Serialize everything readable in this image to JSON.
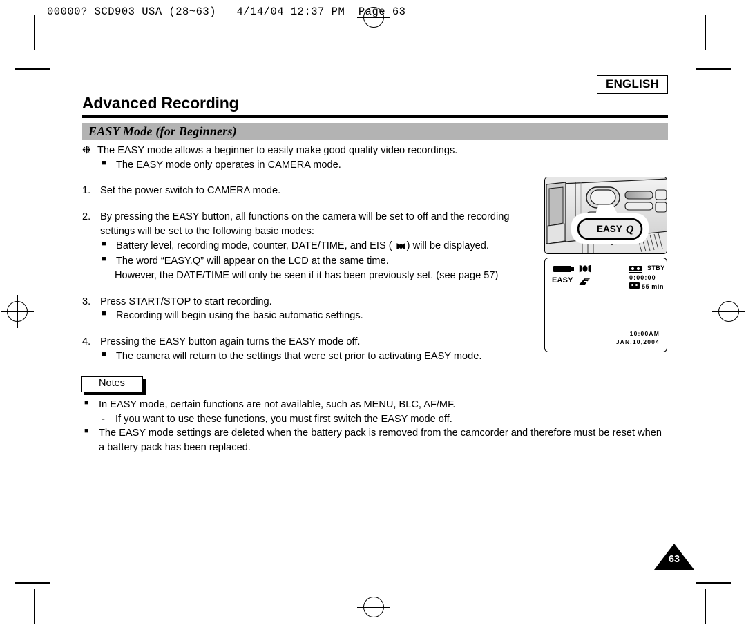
{
  "print_slug": {
    "text": "00000? SCD903 USA (28~63)   4/14/04 12:37 PM  Page 63"
  },
  "header": {
    "language_badge": "ENGLISH",
    "chapter_title": "Advanced Recording",
    "section_title": "EASY Mode (for Beginners)"
  },
  "body": {
    "intro": {
      "marker": "❉",
      "text": "The EASY mode allows a beginner to easily make good quality video recordings.",
      "sub": "The EASY mode only operates in CAMERA mode."
    },
    "steps": [
      {
        "number": "1.",
        "text": "Set the power switch to CAMERA mode.",
        "bullets": []
      },
      {
        "number": "2.",
        "text": "By pressing the EASY button, all functions on the camera will be set to off and the recording settings will be set to the following basic modes:",
        "bullets": [
          {
            "before": "Battery level, recording mode, counter, DATE/TIME, and EIS ( ",
            "icon": "eis-icon",
            "after": ") will be displayed."
          },
          {
            "before": "The word “EASY.Q” will appear on the LCD at the same time.",
            "icon": "",
            "after": ""
          }
        ],
        "continuation": "However, the DATE/TIME will only be seen if it has been previously set. (see page 57)"
      },
      {
        "number": "3.",
        "text": "Press START/STOP to start recording.",
        "bullets": [
          {
            "before": "Recording will begin using the basic automatic settings.",
            "icon": "",
            "after": ""
          }
        ],
        "continuation": ""
      },
      {
        "number": "4.",
        "text": "Pressing the EASY button again turns the EASY mode off.",
        "bullets": [
          {
            "before": "The camera will return to the settings that were set prior to activating EASY mode.",
            "icon": "",
            "after": ""
          }
        ],
        "continuation": ""
      }
    ]
  },
  "notes": {
    "tab_label": "Notes",
    "items": [
      {
        "text": "In EASY mode, certain functions are not available, such as MENU, BLC, AF/MF.",
        "dash_marker": "-",
        "dash_text": "If you want to use these functions, you must first switch the EASY mode off."
      },
      {
        "text": "The EASY mode settings are deleted when the battery pack is removed from the camcorder and therefore must be reset when a battery pack has been replaced.",
        "dash_marker": "",
        "dash_text": ""
      }
    ]
  },
  "figures": {
    "camera_photo": {
      "callout_label": "EASY",
      "callout_q": "Q"
    },
    "lcd_display": {
      "easy_label": "EASY",
      "status": "STBY",
      "counter": "0:00:00",
      "tape_remaining": "55 min",
      "time": "10:00AM",
      "date": "JAN.10,2004"
    }
  },
  "footer": {
    "page_number": "63"
  },
  "colors": {
    "section_bar": "#b3b3b3",
    "ink": "#000000",
    "paper": "#ffffff"
  }
}
